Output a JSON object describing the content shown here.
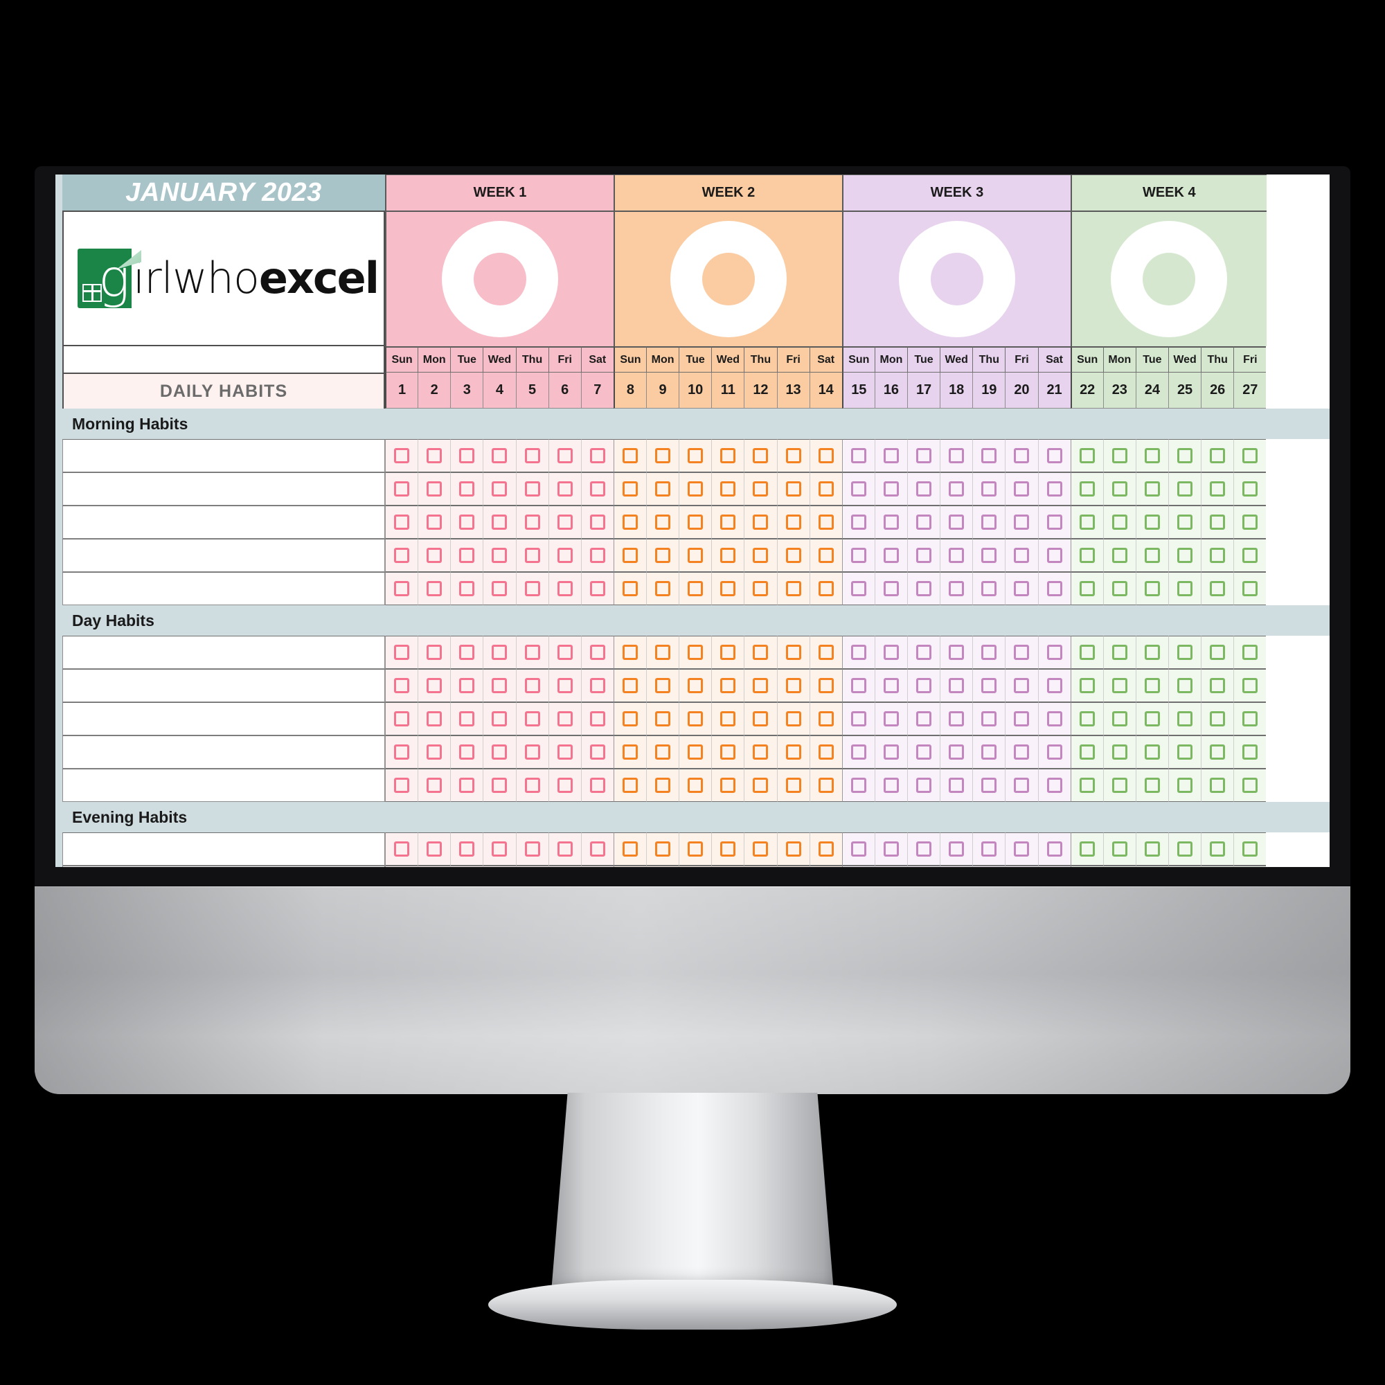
{
  "device": {
    "type": "desktop-monitor"
  },
  "sheet": {
    "month_title": "JANUARY 2023",
    "daily_habits_label": "DAILY HABITS",
    "logo": {
      "light_text": "irlwho",
      "bold_text": "excel",
      "mark_letter": "g"
    },
    "weeks": [
      {
        "label": "WEEK 1",
        "header_bg": "#f7bdc8",
        "body_bg": "#f7bdc8",
        "donut_hole": "#f7bdc8",
        "cell_bg": "#fdf0f1",
        "checkbox_color": "#f4748f",
        "days": [
          "Sun",
          "Mon",
          "Tue",
          "Wed",
          "Thu",
          "Fri",
          "Sat"
        ],
        "dates": [
          "1",
          "2",
          "3",
          "4",
          "5",
          "6",
          "7"
        ]
      },
      {
        "label": "WEEK 2",
        "header_bg": "#fbcca2",
        "body_bg": "#fbcca2",
        "donut_hole": "#fbcca2",
        "cell_bg": "#fdf3ea",
        "checkbox_color": "#f58220",
        "days": [
          "Sun",
          "Mon",
          "Tue",
          "Wed",
          "Thu",
          "Fri",
          "Sat"
        ],
        "dates": [
          "8",
          "9",
          "10",
          "11",
          "12",
          "13",
          "14"
        ]
      },
      {
        "label": "WEEK 3",
        "header_bg": "#e7d3ee",
        "body_bg": "#e7d3ee",
        "donut_hole": "#e7d3ee",
        "cell_bg": "#faf2fb",
        "checkbox_color": "#c386bf",
        "days": [
          "Sun",
          "Mon",
          "Tue",
          "Wed",
          "Thu",
          "Fri",
          "Sat"
        ],
        "dates": [
          "15",
          "16",
          "17",
          "18",
          "19",
          "20",
          "21"
        ]
      },
      {
        "label": "WEEK 4",
        "header_bg": "#d5e8cf",
        "body_bg": "#d5e8cf",
        "donut_hole": "#d5e8cf",
        "cell_bg": "#f1f8ee",
        "checkbox_color": "#7bb861",
        "days": [
          "Sun",
          "Mon",
          "Tue",
          "Wed",
          "Thu",
          "Fri"
        ],
        "dates": [
          "22",
          "23",
          "24",
          "25",
          "26",
          "27"
        ]
      }
    ],
    "sections": [
      {
        "title": "Morning Habits",
        "rows": [
          "",
          "",
          "",
          "",
          ""
        ]
      },
      {
        "title": "Day Habits",
        "rows": [
          "",
          "",
          "",
          "",
          ""
        ]
      },
      {
        "title": "Evening Habits",
        "rows": [
          "",
          "",
          ""
        ]
      }
    ],
    "colors": {
      "month_header_bg": "#a8c4c9",
      "section_header_bg": "#cfdde1",
      "daily_habits_bg": "#fdf2f0",
      "gutter": "#cfdde1"
    }
  }
}
